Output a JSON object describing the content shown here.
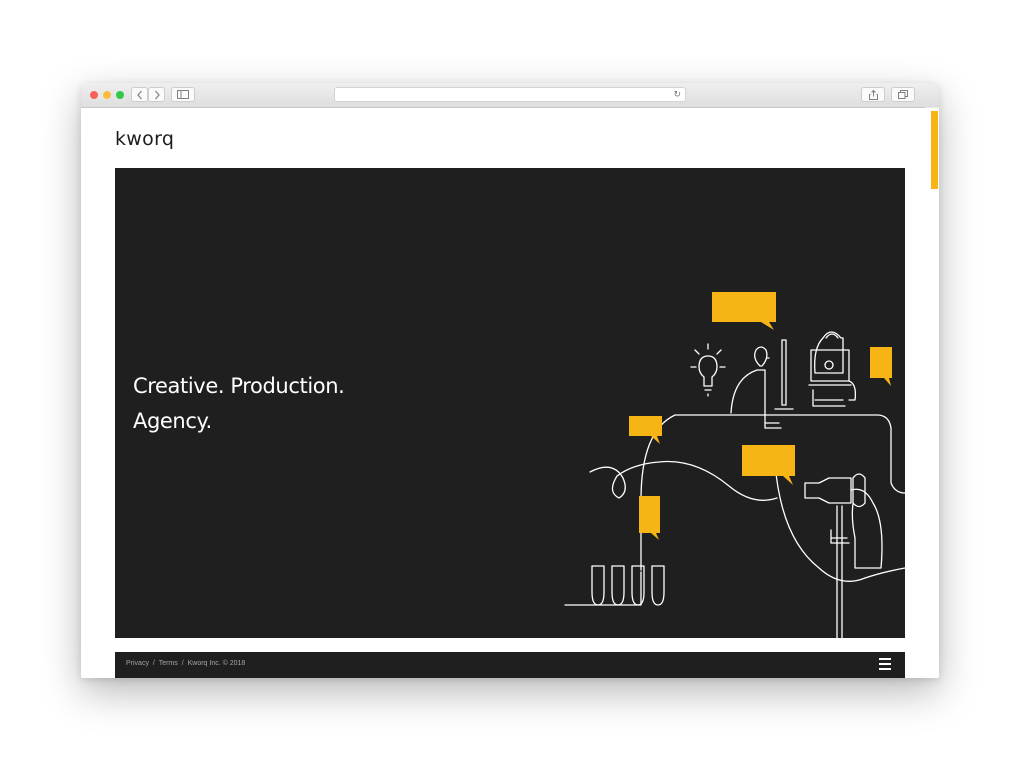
{
  "browser": {
    "nav_back_icon": "chevron-left-icon",
    "nav_forward_icon": "chevron-right-icon",
    "sidebar_icon": "sidebar-icon",
    "url": "",
    "reload_icon": "reload-icon",
    "share_icon": "share-icon",
    "tabs_icon": "tabs-icon",
    "new_tab_icon": "plus-icon",
    "colors": {
      "close": "#fc605b",
      "minimize": "#fdbc40",
      "zoom": "#34c84a"
    }
  },
  "site": {
    "logo": "kworq",
    "hero": {
      "line1": "Creative. Production.",
      "line2": "Agency."
    },
    "footer": {
      "privacy": "Privacy",
      "sep1": "/",
      "terms": "Terms",
      "sep2": "/",
      "copyright": "Kworq Inc. © 2018"
    },
    "menu_icon": "hamburger-menu-icon",
    "colors": {
      "accent": "#f7b515",
      "dark": "#201f20",
      "text_light": "#ffffff",
      "footer_text": "#a5a5a5"
    }
  }
}
